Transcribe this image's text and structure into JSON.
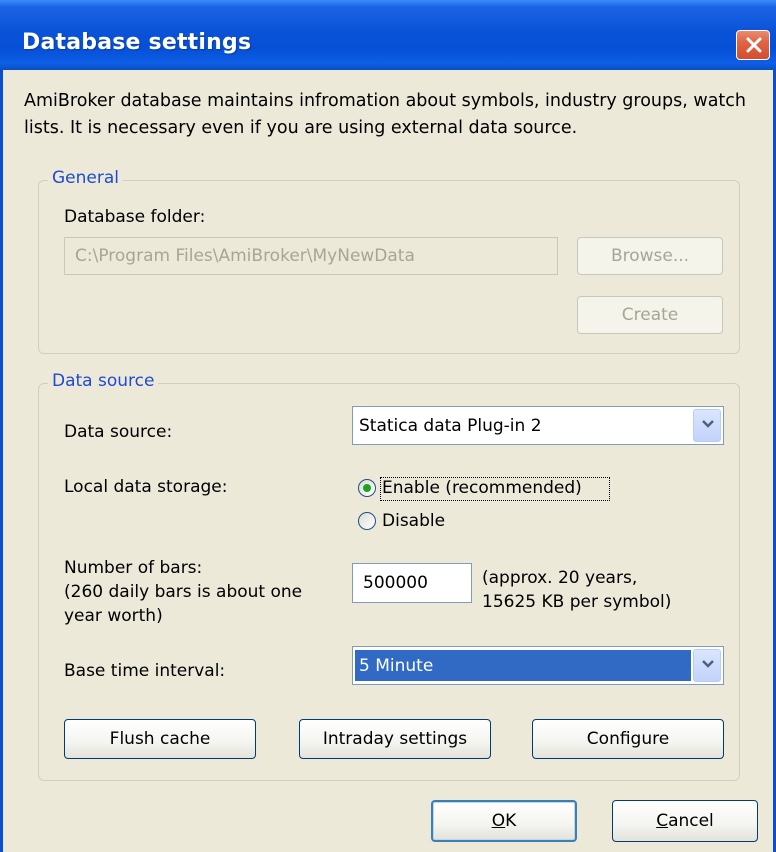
{
  "window": {
    "title": "Database settings",
    "description": "AmiBroker database maintains infromation about symbols, industry groups, watch lists. It is necessary even if you are using external data source."
  },
  "general": {
    "group_title": "General",
    "folder_label": "Database folder:",
    "folder_value": "C:\\Program Files\\AmiBroker\\MyNewData",
    "browse_label": "Browse...",
    "create_label": "Create"
  },
  "data_source": {
    "group_title": "Data source",
    "source_label": "Data source:",
    "source_value": "Statica data Plug-in 2",
    "storage_label": "Local data storage:",
    "enable_label": "Enable (recommended)",
    "disable_label": "Disable",
    "storage_selected": "enable",
    "bars_label_line1": "Number of bars:",
    "bars_label_line2": "(260 daily bars is about one",
    "bars_label_line3": "year worth)",
    "bars_value": "500000",
    "bars_note_line1": "(approx. 20 years,",
    "bars_note_line2": "15625 KB per symbol)",
    "interval_label": "Base time interval:",
    "interval_value": "5 Minute",
    "flush_label": "Flush cache",
    "intraday_label": "Intraday settings",
    "configure_label": "Configure"
  },
  "footer": {
    "ok_first": "O",
    "ok_rest": "K",
    "cancel_first": "C",
    "cancel_rest": "ancel"
  },
  "colors": {
    "title_bar": "#0650d6",
    "selection": "#316ac5",
    "group_title": "#1e4bd2"
  }
}
